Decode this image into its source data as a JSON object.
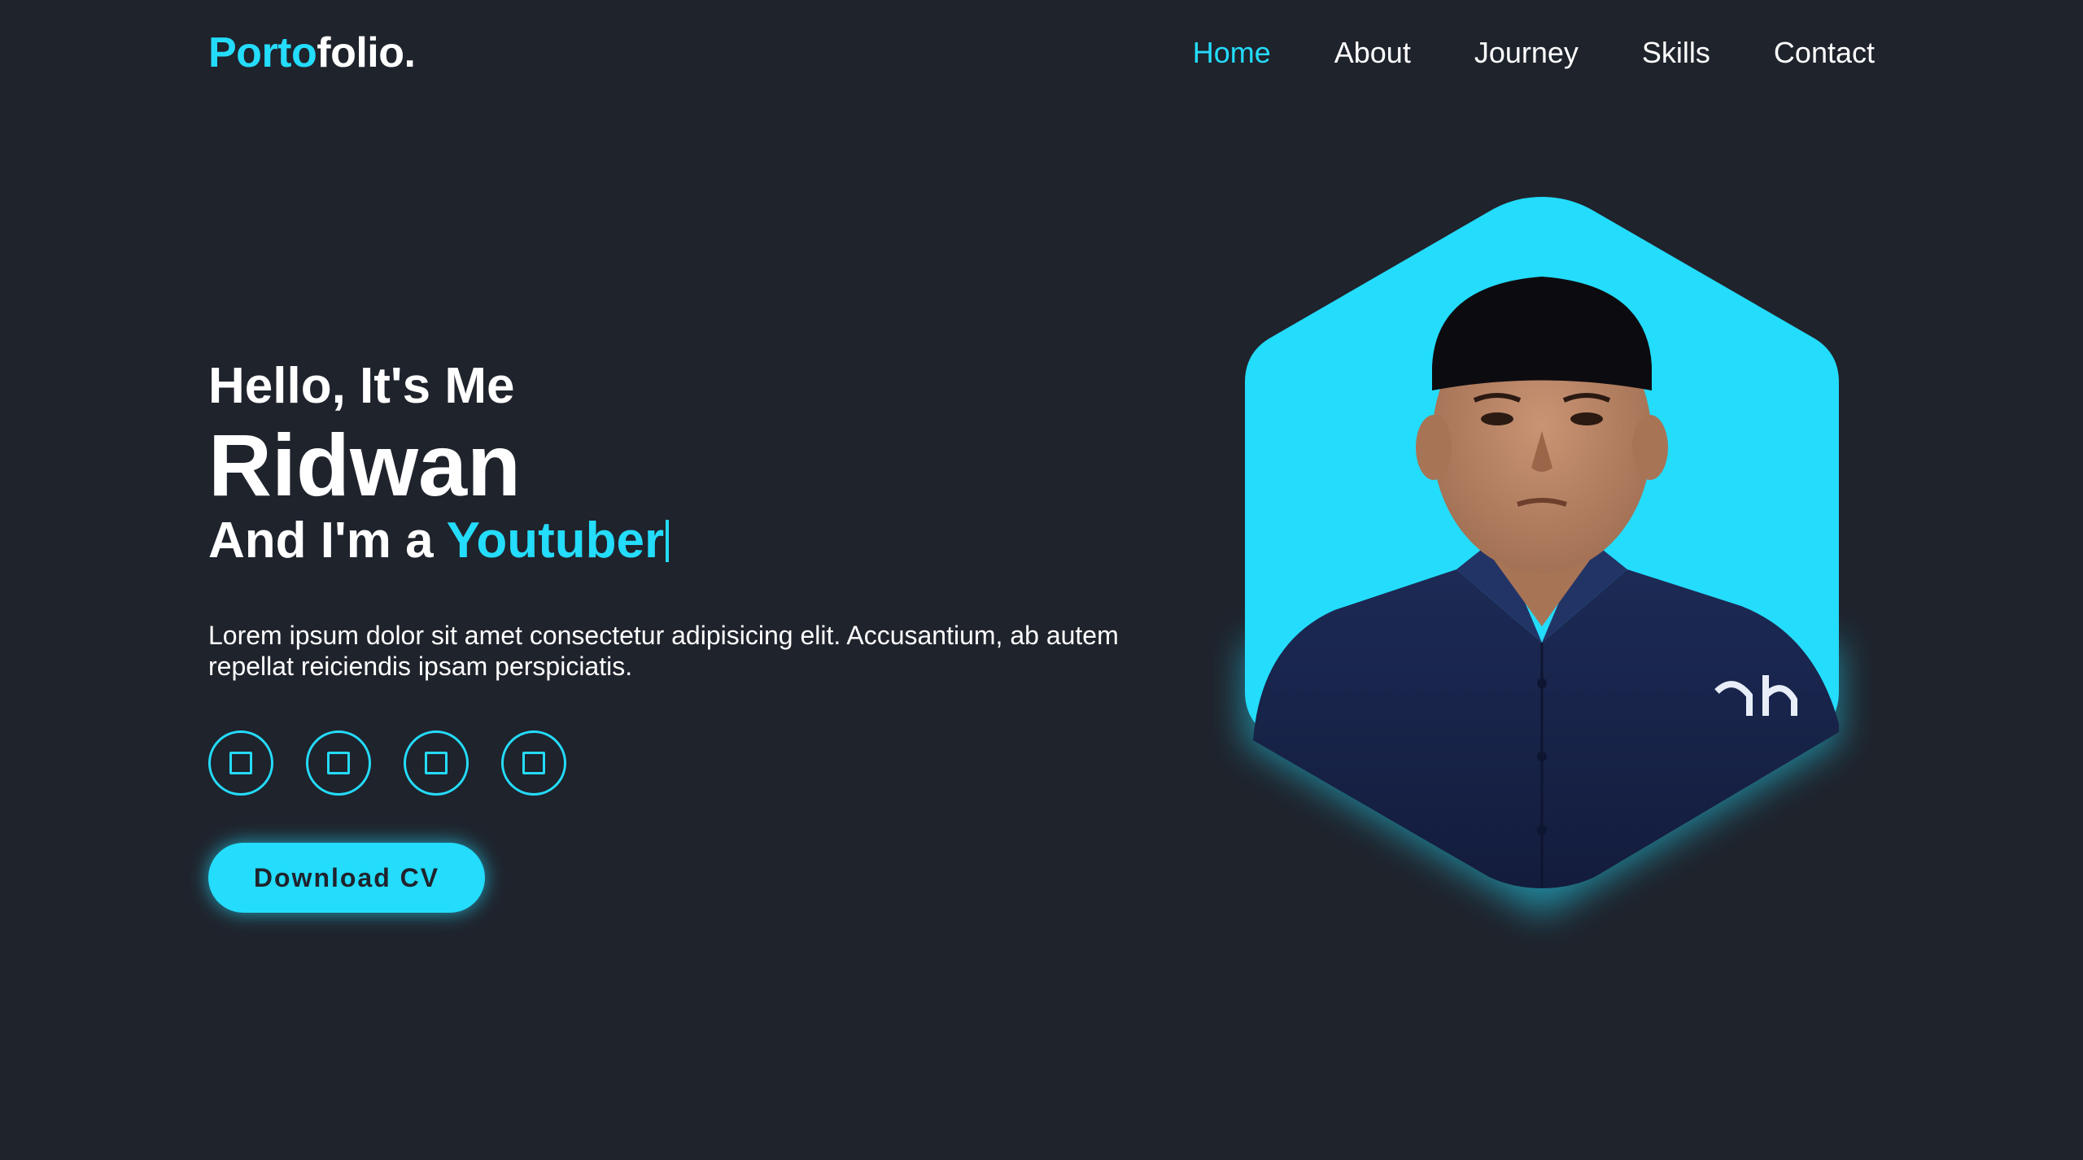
{
  "header": {
    "logo_accent": "Porto",
    "logo_rest": "folio.",
    "nav": [
      "Home",
      "About",
      "Journey",
      "Skills",
      "Contact"
    ]
  },
  "hero": {
    "greeting": "Hello, It's Me",
    "name": "Ridwan",
    "role_prefix": "And I'm a ",
    "role_typed": "Youtuber",
    "description": "Lorem ipsum dolor sit amet consectetur adipisicing elit. Accusantium, ab autem repellat reiciendis ipsam perspiciatis.",
    "download_label": "Download CV"
  },
  "socials": [
    "social-icon",
    "social-icon",
    "social-icon",
    "social-icon"
  ],
  "colors": {
    "background": "#1f232c",
    "accent": "#24dcfb",
    "text": "#ffffff"
  }
}
